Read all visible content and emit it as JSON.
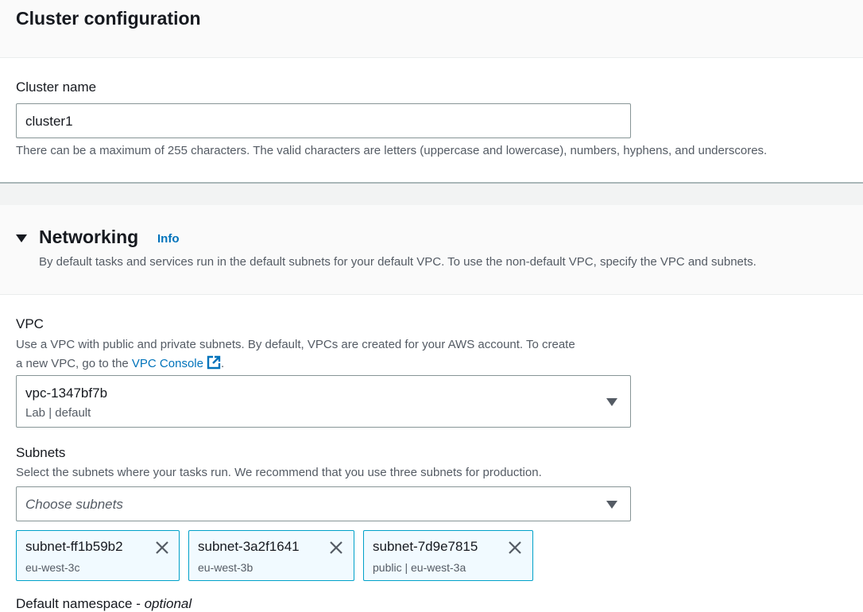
{
  "cluster_config": {
    "title": "Cluster configuration",
    "name_label": "Cluster name",
    "name_value": "cluster1",
    "name_hint": "There can be a maximum of 255 characters. The valid characters are letters (uppercase and lowercase), numbers, hyphens, and underscores."
  },
  "networking": {
    "title": "Networking",
    "info_link": "Info",
    "description": "By default tasks and services run in the default subnets for your default VPC. To use the non-default VPC, specify the VPC and subnets.",
    "vpc": {
      "label": "VPC",
      "hint_line1": "Use a VPC with public and private subnets. By default, VPCs are created for your AWS account. To create",
      "hint_line2_prefix": "a new VPC, go to the ",
      "hint_link": "VPC Console",
      "hint_line2_suffix": ".",
      "selected_value": "vpc-1347bf7b",
      "selected_subtext": "Lab | default"
    },
    "subnets": {
      "label": "Subnets",
      "hint": "Select the subnets where your tasks run. We recommend that you use three subnets for production.",
      "placeholder": "Choose subnets",
      "selected": [
        {
          "name": "subnet-ff1b59b2",
          "detail": "eu-west-3c"
        },
        {
          "name": "subnet-3a2f1641",
          "detail": "eu-west-3b"
        },
        {
          "name": "subnet-7d9e7815",
          "detail": "public | eu-west-3a"
        }
      ]
    },
    "namespace_label": "Default namespace - optional"
  },
  "colors": {
    "link": "#0073bb",
    "token_border": "#00a1c9",
    "token_bg": "#f1faff"
  }
}
